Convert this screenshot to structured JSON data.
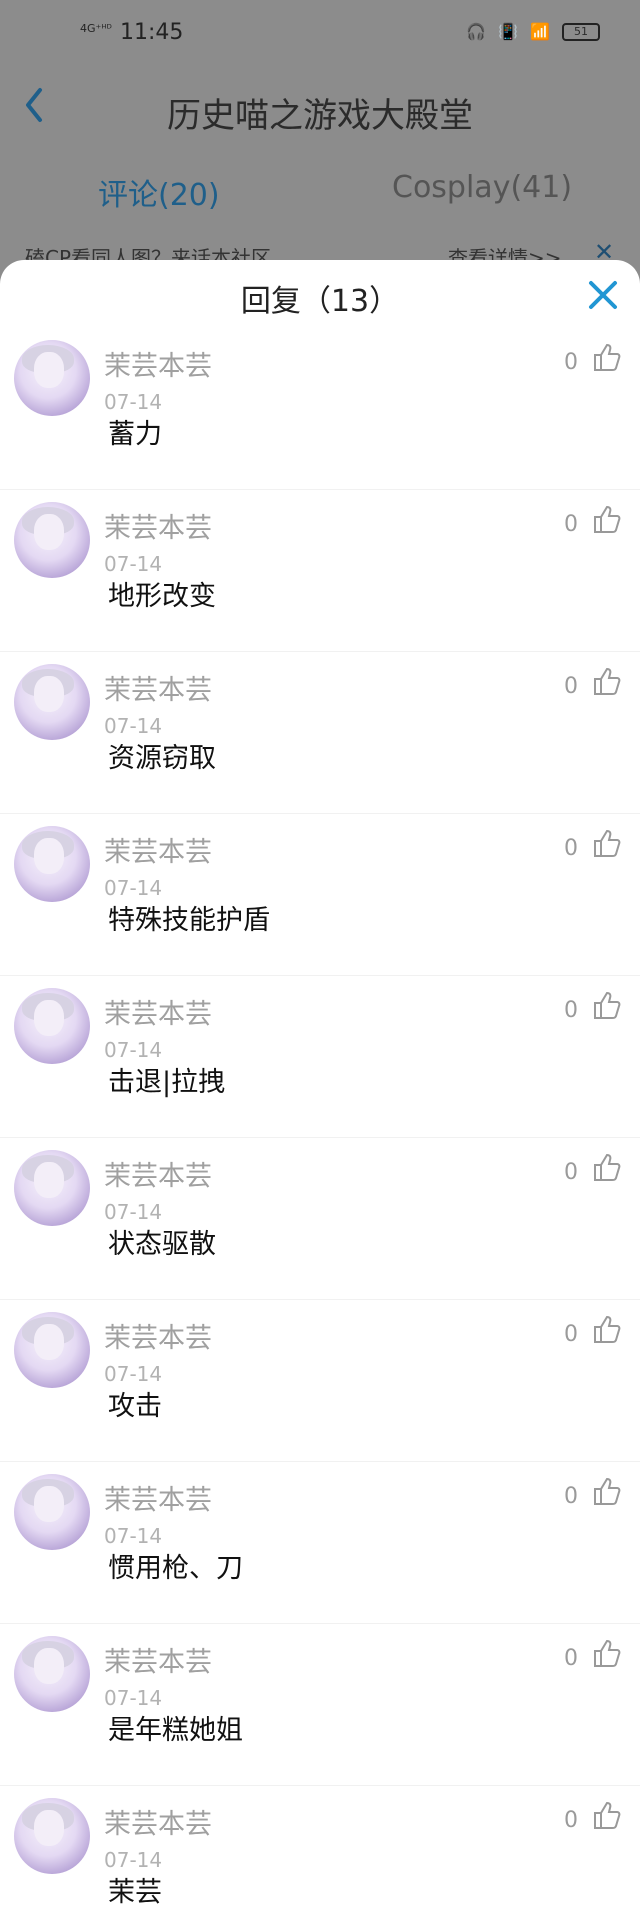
{
  "status_bar": {
    "signal_text": "4G⁺ᴴᴰ",
    "time": "11:45",
    "battery": "51"
  },
  "header": {
    "title": "历史喵之游戏大殿堂"
  },
  "tabs": [
    {
      "label": "评论(20)"
    },
    {
      "label": "Cosplay(41)"
    }
  ],
  "banner": {
    "text": "磕CP看同人图？来话本社区",
    "link": "查看详情>>"
  },
  "sheet": {
    "title": "回复（13）",
    "replies": [
      {
        "author": "茉芸本芸",
        "date": "07-14",
        "content": "蓄力",
        "likes": "0"
      },
      {
        "author": "茉芸本芸",
        "date": "07-14",
        "content": "地形改变",
        "likes": "0"
      },
      {
        "author": "茉芸本芸",
        "date": "07-14",
        "content": "资源窃取",
        "likes": "0"
      },
      {
        "author": "茉芸本芸",
        "date": "07-14",
        "content": "特殊技能护盾",
        "likes": "0"
      },
      {
        "author": "茉芸本芸",
        "date": "07-14",
        "content": "击退|拉拽",
        "likes": "0"
      },
      {
        "author": "茉芸本芸",
        "date": "07-14",
        "content": "状态驱散",
        "likes": "0"
      },
      {
        "author": "茉芸本芸",
        "date": "07-14",
        "content": "攻击",
        "likes": "0"
      },
      {
        "author": "茉芸本芸",
        "date": "07-14",
        "content": "惯用枪、刀",
        "likes": "0"
      },
      {
        "author": "茉芸本芸",
        "date": "07-14",
        "content": "是年糕她姐",
        "likes": "0"
      },
      {
        "author": "茉芸本芸",
        "date": "07-14",
        "content": "茉芸",
        "likes": "0"
      }
    ]
  },
  "colors": {
    "accent": "#2196d3",
    "overlay": "#8c8c8c"
  }
}
